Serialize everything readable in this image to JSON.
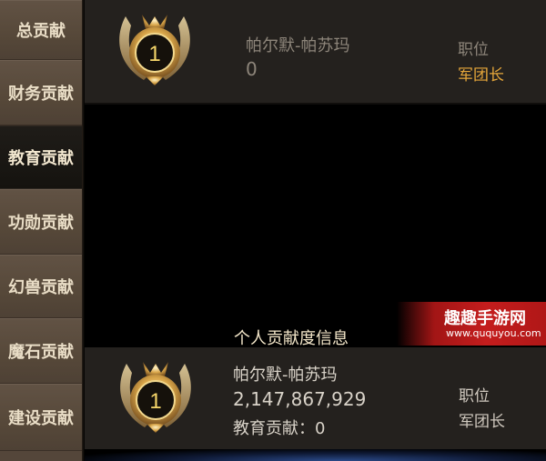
{
  "sidebar": {
    "items": [
      {
        "label": "总贡献"
      },
      {
        "label": "财务贡献"
      },
      {
        "label": "教育贡献"
      },
      {
        "label": "功勋贡献"
      },
      {
        "label": "幻兽贡献"
      },
      {
        "label": "魔石贡献"
      },
      {
        "label": "建设贡献"
      }
    ]
  },
  "top_entry": {
    "rank": "1",
    "name": "帕尔默-帕苏玛",
    "score": "0",
    "position_label": "职位",
    "position_value": "军团长"
  },
  "personal": {
    "title": "个人贡献度信息",
    "rank": "1",
    "name": "帕尔默-帕苏玛",
    "total": "2,147,867,929",
    "contribution": "教育贡献：0",
    "position_label": "职位",
    "position_value": "军团长"
  },
  "watermark": {
    "title": "趣趣手游网",
    "url": "www.ququyou.com"
  },
  "colors": {
    "sidebar": "#54463a",
    "row_bg": "#24211e",
    "gold_text": "#e6a73a",
    "watermark_red": "#c41d1d"
  }
}
